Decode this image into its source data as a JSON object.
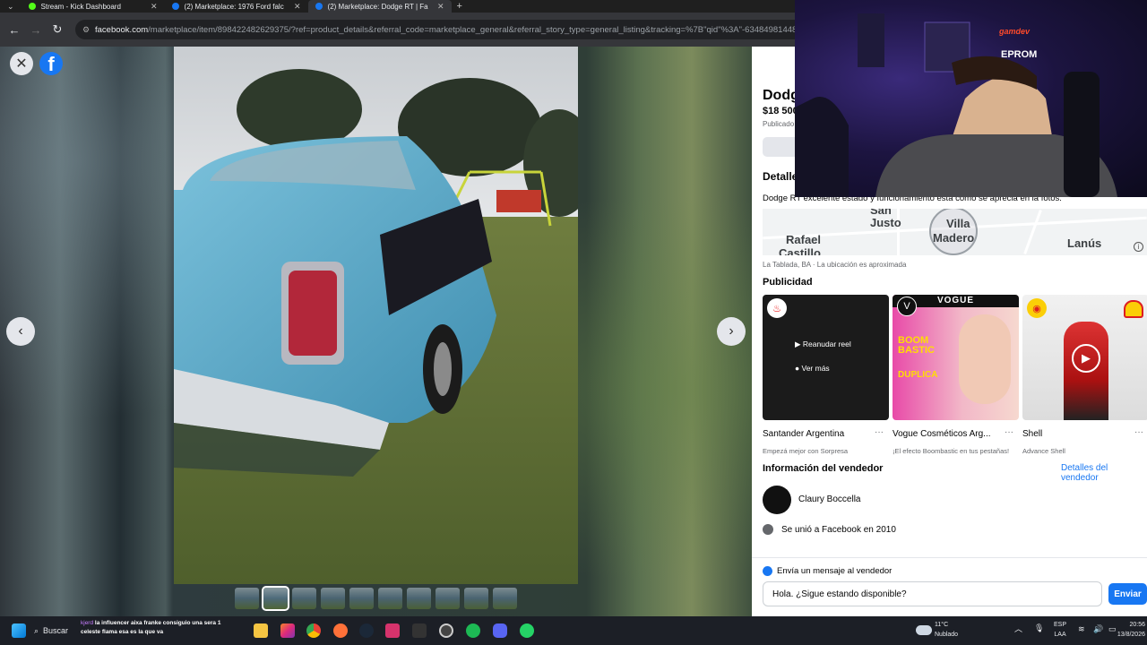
{
  "browser": {
    "tabs": [
      {
        "title": "Stream - Kick Dashboard",
        "color": "#53fc18"
      },
      {
        "title": "(2) Marketplace: 1976 Ford falc",
        "color": "#1877f2"
      },
      {
        "title": "(2) Marketplace: Dodge RT | Fa",
        "color": "#1877f2"
      }
    ],
    "new_tab": "+",
    "url_main": "facebook.com",
    "url_rest": "/marketplace/item/898422482629375/?ref=product_details&referral_code=marketplace_general&referral_story_type=general_listing&tracking=%7B\"qid\"%3A\"-634849814484"
  },
  "viewer": {
    "close": "✕",
    "logo": "f",
    "prev": "‹",
    "next": "›",
    "thumb_count": 10
  },
  "listing": {
    "title": "Dodge",
    "price": "$18 500",
    "published": "Publicado",
    "details_heading": "Detalle",
    "description": "Dodge RT excelente estado y funcionamiento está como se aprecia en la fotos.",
    "map_labels": [
      "San",
      "Justo",
      "Villa",
      "Madero",
      "Rafael",
      "Castillo",
      "Lanús"
    ],
    "map_info": "i",
    "location": "La Tablada, BA · La ubicación es aproximada"
  },
  "ads": {
    "heading": "Publicidad",
    "items": [
      {
        "name": "Santander Argentina",
        "sub": "Empezá mejor con Sorpresa",
        "brand": "#ec0000",
        "overlay": [
          "Reanudar reel",
          "Ver más"
        ]
      },
      {
        "name": "Vogue Cosméticos Arg...",
        "sub": "¡El efecto Boombastic en tus pestañas!",
        "brand": "#000000",
        "tag": "VOGUE",
        "headline": "BOOM BASTIC",
        "sub2": "DUPLICA"
      },
      {
        "name": "Shell",
        "sub": "Advance Shell",
        "brand": "#fbce07"
      }
    ],
    "dots": "···"
  },
  "seller": {
    "heading": "Información del vendedor",
    "link": "Detalles del vendedor",
    "name": "Claury Boccella",
    "joined": "Se unió a Facebook en 2010"
  },
  "message": {
    "label": "Envía un mensaje al vendedor",
    "value": "Hola. ¿Sigue estando disponible?",
    "send": "Enviar"
  },
  "webcam": {
    "brand1": "gamdev",
    "brand2": "EPROM"
  },
  "taskbar": {
    "search": "Buscar",
    "chat_user": "kjerd",
    "chat_msg": "la influencer aixa franke consiguio una sera 1 celeste flama esa es la que va",
    "weather_temp": "11°C",
    "weather_desc": "Nublado",
    "lang1": "ESP",
    "lang2": "LAA",
    "time": "20:56",
    "date": "13/8/2026"
  }
}
